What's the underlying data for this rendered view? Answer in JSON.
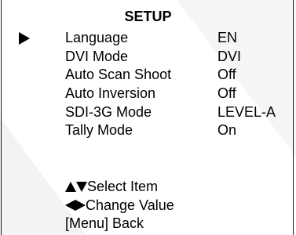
{
  "menu": {
    "title": "SETUP",
    "selected_index": 0,
    "items": [
      {
        "label": "Language",
        "value": "EN"
      },
      {
        "label": "DVI Mode",
        "value": "DVI"
      },
      {
        "label": "Auto Scan Shoot",
        "value": "Off"
      },
      {
        "label": "Auto Inversion",
        "value": "Off"
      },
      {
        "label": "SDI-3G Mode",
        "value": "LEVEL-A"
      },
      {
        "label": "Tally Mode",
        "value": "On"
      }
    ]
  },
  "help": {
    "select_item": "Select Item",
    "change_value": "Change Value",
    "menu_back": "[Menu] Back"
  },
  "icons": {
    "selector": "play-arrow-icon",
    "up": "triangle-up-icon",
    "down": "triangle-down-icon",
    "left": "triangle-left-icon",
    "right": "triangle-right-icon"
  },
  "colors": {
    "text": "#000000",
    "background": "#ffffff",
    "frame": "#1a1a1a"
  }
}
